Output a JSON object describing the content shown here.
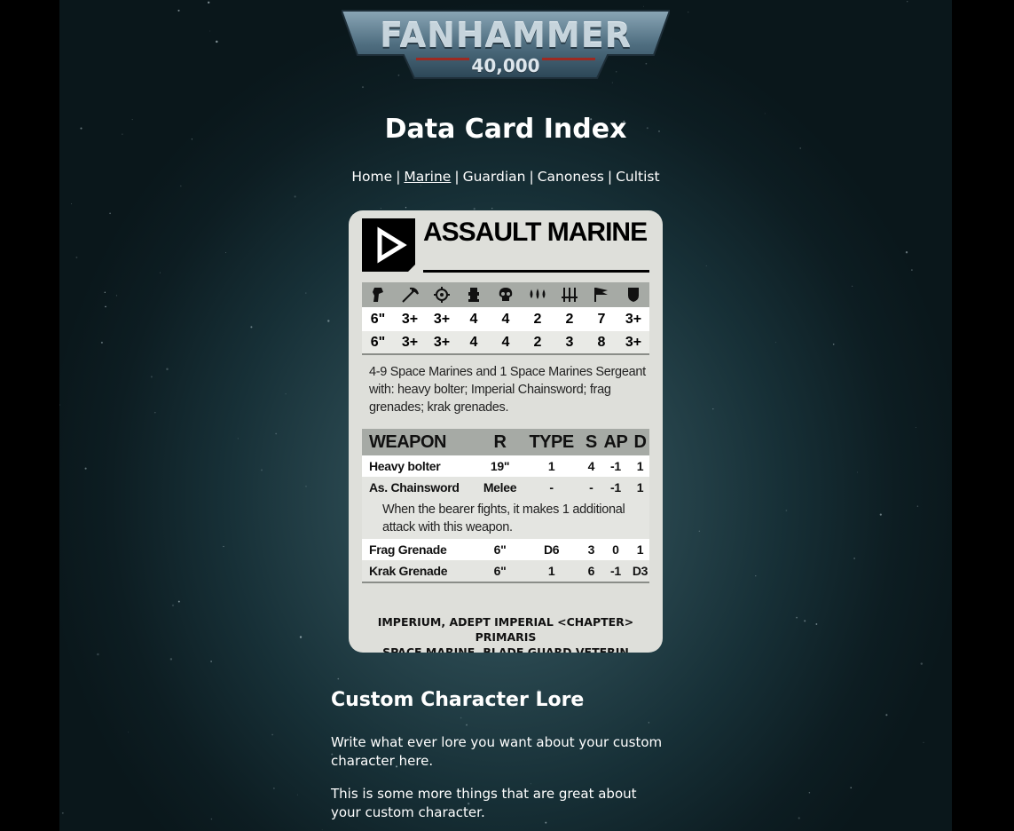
{
  "logo": {
    "title": "FANHAMMER",
    "subtitle": "40,000"
  },
  "page_title": "Data Card Index",
  "nav": {
    "items": [
      {
        "label": "Home",
        "active": false
      },
      {
        "label": "Marine",
        "active": true
      },
      {
        "label": "Guardian",
        "active": false
      },
      {
        "label": "Canoness",
        "active": false
      },
      {
        "label": "Cultist",
        "active": false
      }
    ],
    "separator": "|"
  },
  "card": {
    "name": "ASSAULT MARINE",
    "stat_icons": [
      "movement-icon",
      "weapon-skill-icon",
      "ballistic-skill-icon",
      "strength-icon",
      "toughness-icon",
      "wounds-icon",
      "attacks-icon",
      "leadership-icon",
      "save-icon"
    ],
    "stat_rows": [
      [
        "6\"",
        "3+",
        "3+",
        "4",
        "4",
        "2",
        "2",
        "7",
        "3+"
      ],
      [
        "6\"",
        "3+",
        "3+",
        "4",
        "4",
        "2",
        "3",
        "8",
        "3+"
      ]
    ],
    "description": "4-9 Space Marines and 1 Space Marines Sergeant with: heavy bolter; Imperial Chainsword; frag grenades; krak grenades.",
    "weapon_headers": {
      "name": "WEAPON",
      "r": "R",
      "type": "TYPE",
      "s": "S",
      "ap": "AP",
      "d": "D"
    },
    "weapons": [
      {
        "name": "Heavy bolter",
        "r": "19\"",
        "type": "1",
        "s": "4",
        "ap": "-1",
        "d": "1"
      },
      {
        "name": "As. Chainsword",
        "r": "Melee",
        "type": "-",
        "s": "-",
        "ap": "-1",
        "d": "1"
      },
      {
        "name": "Frag Grenade",
        "r": "6\"",
        "type": "D6",
        "s": "3",
        "ap": "0",
        "d": "1"
      },
      {
        "name": "Krak Grenade",
        "r": "6\"",
        "type": "1",
        "s": "6",
        "ap": "-1",
        "d": "D3"
      }
    ],
    "weapon_note": "When the bearer fights, it makes 1 additional attack with this weapon.",
    "keywords_line1": "IMPERIUM, ADEPT IMPERIAL <CHAPTER> PRIMARIS",
    "keywords_line2": "SPACE MARINE, BLADE GUARD VETERIN"
  },
  "lore": {
    "title": "Custom Character Lore",
    "paragraphs": [
      "Write what ever lore you want about your custom character here.",
      "This is some more things that are great about your custom character."
    ]
  }
}
